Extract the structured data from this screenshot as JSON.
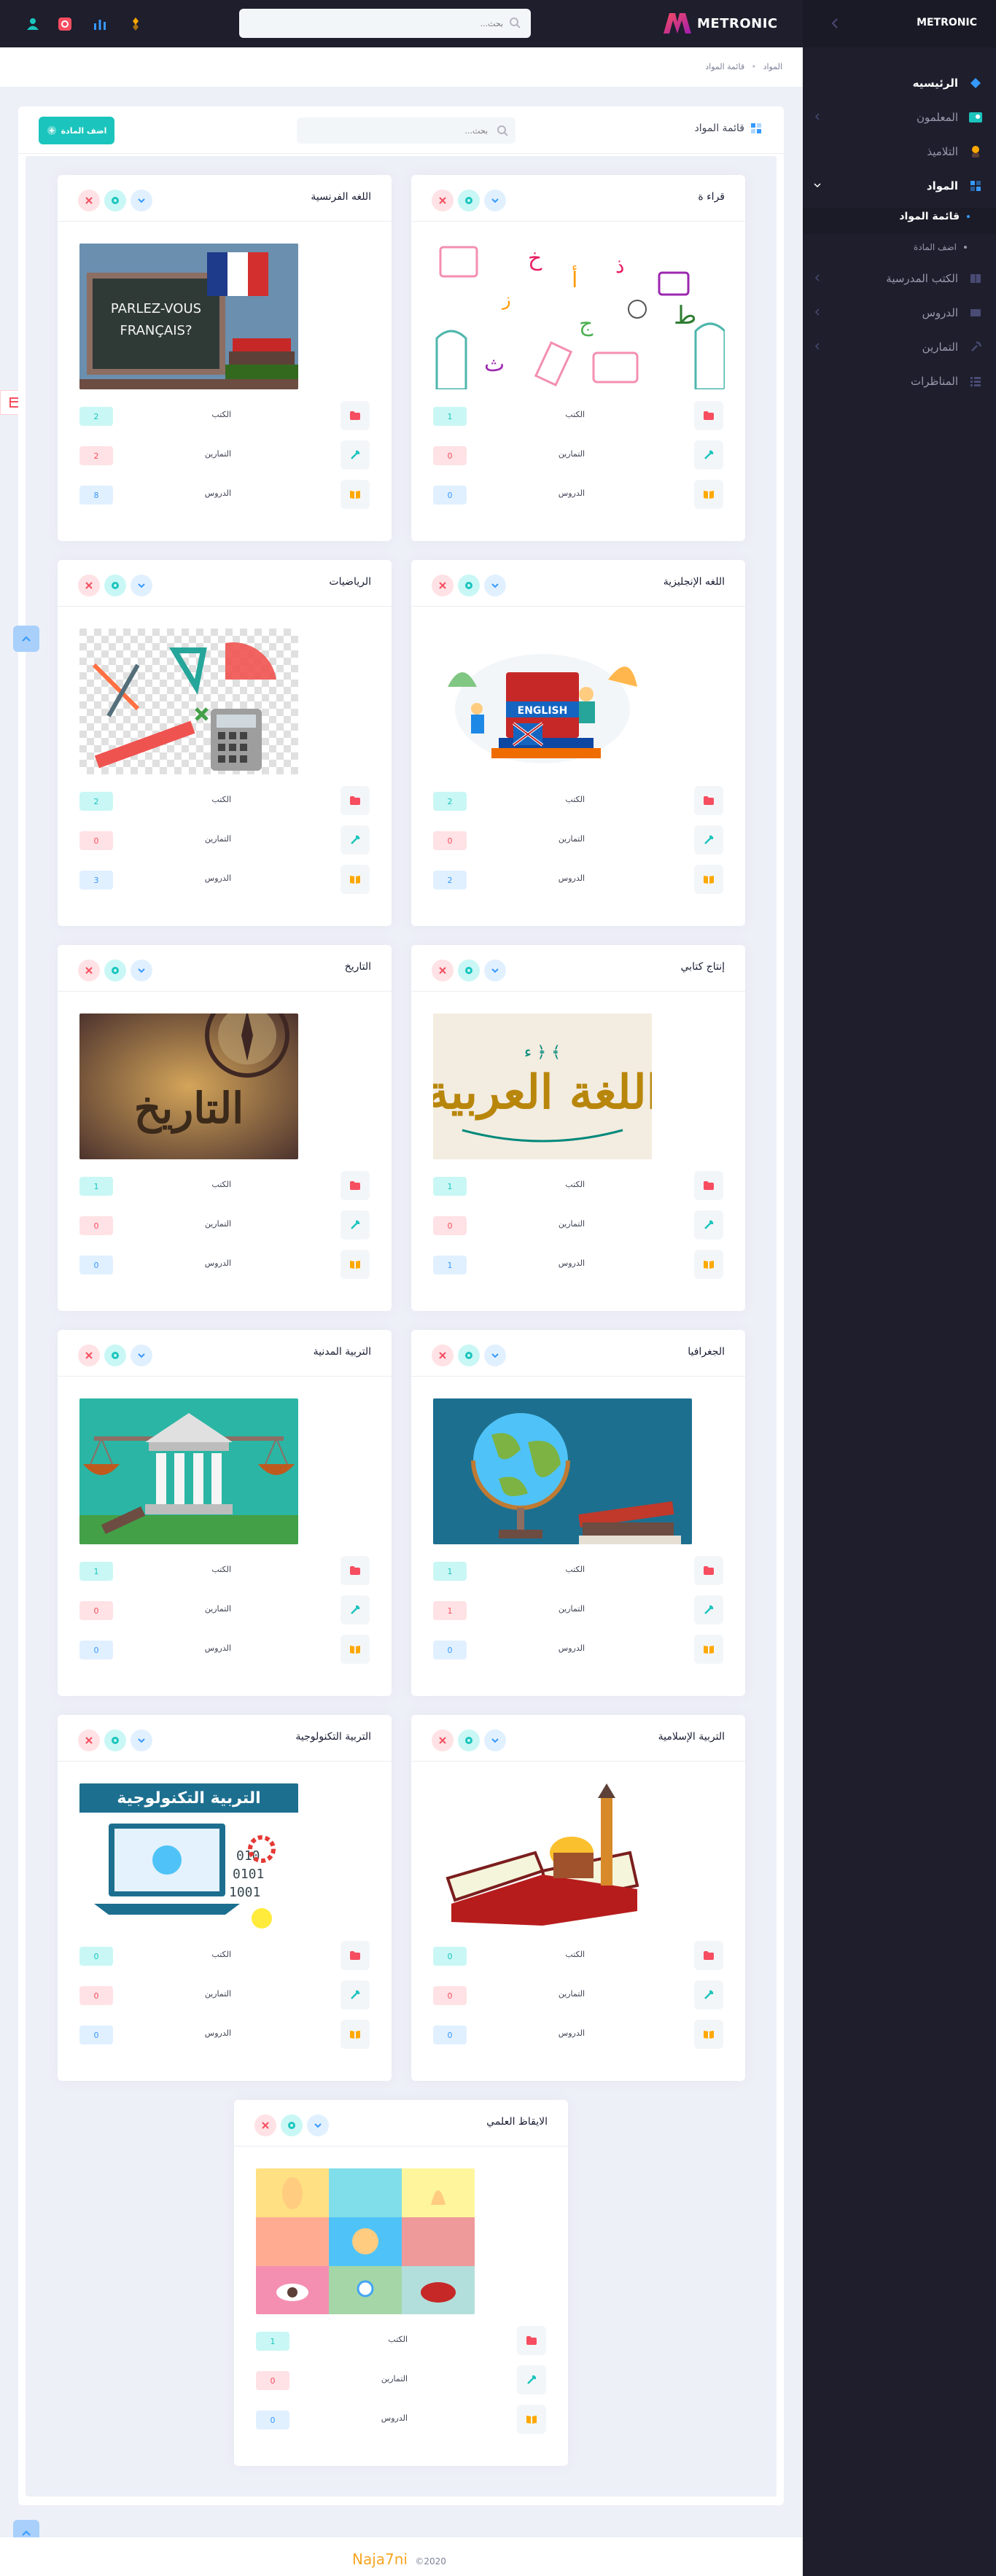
{
  "app": {
    "brand": "METRONIC",
    "sidebar_title": "METRONIC"
  },
  "search": {
    "placeholder": "بحث..."
  },
  "sidebar": {
    "items": [
      {
        "label": "الرئيسيه",
        "icon": "diamond-icon"
      },
      {
        "label": "المعلمون",
        "icon": "teachers-icon"
      },
      {
        "label": "التلاميذ",
        "icon": "student-icon"
      },
      {
        "label": "المواد",
        "icon": "apps-icon"
      },
      {
        "label": "قائمة المواد",
        "icon": "dot-icon"
      },
      {
        "label": "اضف المادة",
        "icon": "dot-icon"
      },
      {
        "label": "الكتب المدرسية",
        "icon": "books-icon"
      },
      {
        "label": "الدروس",
        "icon": "lessons-icon"
      },
      {
        "label": "التمارين",
        "icon": "tools-icon"
      },
      {
        "label": "المناظرات",
        "icon": "list-icon"
      }
    ]
  },
  "breadcrumbs": [
    "المواد",
    "قائمة المواد"
  ],
  "list": {
    "title": "قائمة المواد",
    "add_label": "اضف المادة",
    "search_placeholder": "بحث..."
  },
  "stat_labels": {
    "books": "الكتب",
    "exercises": "التمارين",
    "lessons": "الدروس"
  },
  "subjects": [
    {
      "title": "قراء ة",
      "books": "1",
      "exercises": "0",
      "lessons": "0",
      "image": "arabic-letters"
    },
    {
      "title": "اللغه الفرنسية",
      "books": "2",
      "exercises": "2",
      "lessons": "8",
      "image": "parlez-vous-francais"
    },
    {
      "title": "اللغه الإنجليزية",
      "books": "2",
      "exercises": "0",
      "lessons": "2",
      "image": "english-books"
    },
    {
      "title": "الرياضيات",
      "books": "2",
      "exercises": "0",
      "lessons": "3",
      "image": "math-tools"
    },
    {
      "title": "إنتاج كتابي",
      "books": "1",
      "exercises": "0",
      "lessons": "1",
      "image": "arabic-calligraphy"
    },
    {
      "title": "التاريخ",
      "books": "1",
      "exercises": "0",
      "lessons": "0",
      "image": "history-compass"
    },
    {
      "title": "الجغرافيا",
      "books": "1",
      "exercises": "1",
      "lessons": "0",
      "image": "globe-books"
    },
    {
      "title": "التربية المدنية",
      "books": "1",
      "exercises": "0",
      "lessons": "0",
      "image": "justice-scale"
    },
    {
      "title": "التربية الإسلامية",
      "books": "0",
      "exercises": "0",
      "lessons": "0",
      "image": "mosque-book"
    },
    {
      "title": "التربية التكنولوجية",
      "books": "0",
      "exercises": "0",
      "lessons": "0",
      "image": "technology-laptop"
    },
    {
      "title": "الايقاظ العلمي",
      "books": "1",
      "exercises": "0",
      "lessons": "0",
      "image": "science-senses"
    }
  ],
  "tech_image_caption": "التربية   التكنولوجية",
  "history_image_caption": "التاريخ",
  "french_image_caption": "PARLEZ-VOUS FRANÇAIS?",
  "english_image_caption": "ENGLISH",
  "calligraphy_image_caption": "اللغة العربية",
  "footer": {
    "brand": "Naja7ni",
    "year": "©2020"
  },
  "colors": {
    "accent": "#1bc5bd",
    "danger": "#f64e60",
    "primary": "#3699ff",
    "dark": "#1e1e2d",
    "warning": "#ffa800"
  }
}
